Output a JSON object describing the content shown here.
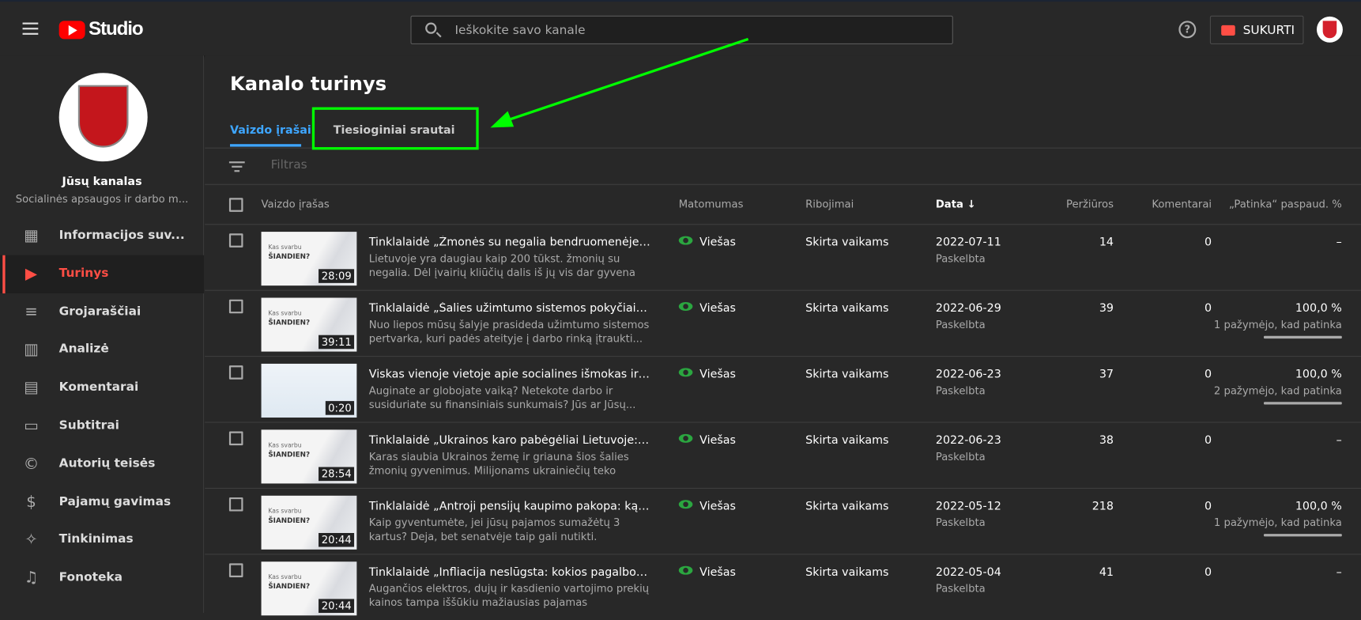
{
  "header": {
    "app_name": "Studio",
    "search_placeholder": "Ieškokite savo kanale",
    "create_label": "SUKURTI"
  },
  "channel": {
    "label": "Jūsų kanalas",
    "name": "Socialinės apsaugos ir darbo m..."
  },
  "sidebar": {
    "items": [
      {
        "label": "Informacijos suv...",
        "icon": "dashboard-icon"
      },
      {
        "label": "Turinys",
        "icon": "content-icon",
        "active": true
      },
      {
        "label": "Grojaraščiai",
        "icon": "playlist-icon"
      },
      {
        "label": "Analizė",
        "icon": "analytics-icon"
      },
      {
        "label": "Komentarai",
        "icon": "comments-icon"
      },
      {
        "label": "Subtitrai",
        "icon": "subtitles-icon"
      },
      {
        "label": "Autorių teisės",
        "icon": "copyright-icon"
      },
      {
        "label": "Pajamų gavimas",
        "icon": "dollar-icon"
      },
      {
        "label": "Tinkinimas",
        "icon": "magic-wand-icon"
      },
      {
        "label": "Fonoteka",
        "icon": "audio-library-icon"
      }
    ]
  },
  "page": {
    "title": "Kanalo turinys",
    "tabs": [
      {
        "label": "Vaizdo įrašai",
        "active": true
      },
      {
        "label": "Tiesioginiai srautai"
      }
    ],
    "filter_placeholder": "Filtras"
  },
  "table": {
    "headers": {
      "video": "Vaizdo įrašas",
      "visibility": "Matomumas",
      "restrictions": "Ribojimai",
      "date": "Data",
      "views": "Peržiūros",
      "comments": "Komentarai",
      "likes": "„Patinka“ paspaud. %"
    },
    "rows": [
      {
        "duration": "28:09",
        "title": "Tinklalaidė „Žmonės su negalia bendruomenėje: ko ...",
        "desc": "Lietuvoje yra daugiau kaip 200 tūkst. žmonių su negalia. Dėl įvairių kliūčių dalis iš jų vis dar gyvena izoliuoti....",
        "visibility": "Viešas",
        "restriction": "Skirta vaikams",
        "date": "2022-07-11",
        "status": "Paskelbta",
        "views": "14",
        "comments": "0",
        "likes": "–"
      },
      {
        "duration": "39:11",
        "title": "Tinklalaidė „Šalies užimtumo sistemos pokyčiai: ką ...",
        "desc": "Nuo liepos mūsų šalyje prasideda užimtumo sistemos pertvarka, kuri padės ateityje į darbo rinką įtraukti...",
        "visibility": "Viešas",
        "restriction": "Skirta vaikams",
        "date": "2022-06-29",
        "status": "Paskelbta",
        "views": "39",
        "comments": "0",
        "likes": "100,0 %",
        "likes_sub": "1 pažymėjo, kad patinka",
        "like_ratio": 1.0
      },
      {
        "duration": "0:20",
        "title": "Viskas vienoje vietoje apie socialines išmokas ir pas...",
        "desc": "Auginate ar globojate vaiką? Netekote darbo ir susiduriate su finansiniais sunkumais? Jūs ar Jūsų...",
        "visibility": "Viešas",
        "restriction": "Skirta vaikams",
        "date": "2022-06-23",
        "status": "Paskelbta",
        "views": "37",
        "comments": "0",
        "likes": "100,0 %",
        "likes_sub": "2 pažymėjo, kad patinka",
        "like_ratio": 1.0
      },
      {
        "duration": "28:54",
        "title": "Tinklalaidė „Ukrainos karo pabėgėliai Lietuvoje: pat...",
        "desc": "Karas siaubia Ukrainos žemę ir griauna šios šalies žmonių gyvenimus. Milijonams ukrainiečių teko priimti...",
        "visibility": "Viešas",
        "restriction": "Skirta vaikams",
        "date": "2022-06-23",
        "status": "Paskelbta",
        "views": "38",
        "comments": "0",
        "likes": "–"
      },
      {
        "duration": "20:44",
        "title": "Tinklalaidė „Antroji pensijų kaupimo pakopa: ką reik...",
        "desc": "Kaip gyventumėte, jei jūsų pajamos sumažėtų 3 kartus? Deja, bet senatvėje taip gali nutikti. Prognozuojama, k...",
        "visibility": "Viešas",
        "restriction": "Skirta vaikams",
        "date": "2022-05-12",
        "status": "Paskelbta",
        "views": "218",
        "comments": "0",
        "likes": "100,0 %",
        "likes_sub": "1 pažymėjo, kad patinka",
        "like_ratio": 1.0
      },
      {
        "duration": "20:44",
        "title": "Tinklalaidė „Infliacija neslūgsta: kokios pagalbos sul...",
        "desc": "Augančios elektros, dujų ir kasdienio vartojimo prekių kainos tampa iššūkiu mažiausias pajamas gaunantiem...",
        "visibility": "Viešas",
        "restriction": "Skirta vaikams",
        "date": "2022-05-04",
        "status": "Paskelbta",
        "views": "41",
        "comments": "0",
        "likes": "–"
      }
    ]
  },
  "thumb_text": {
    "line1": "Kas svarbu",
    "line2": "ŠIANDIEN?"
  },
  "colors": {
    "accent_red": "#ff4e45",
    "tab_blue": "#3ea6ff",
    "annotation_green": "#00ff00",
    "public_green": "#2ba640"
  }
}
